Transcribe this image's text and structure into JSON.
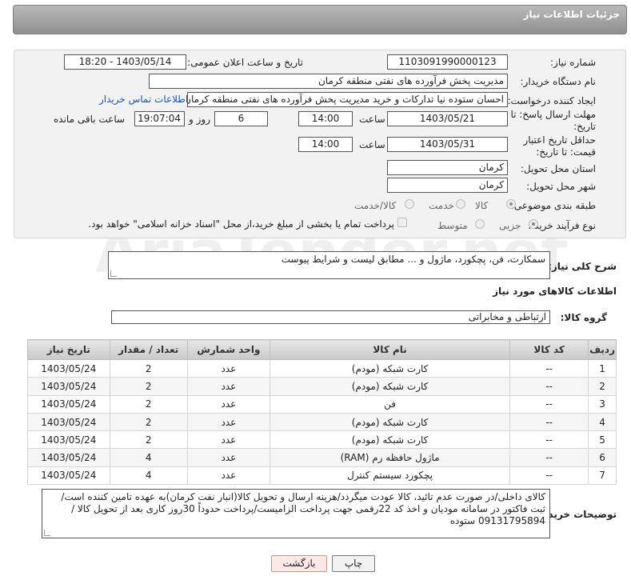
{
  "header": {
    "title": "جزئیات اطلاعات نیاز"
  },
  "form": {
    "need_number_label": "شماره نیاز:",
    "need_number": "1103091990000123",
    "announce_label": "تاریخ و ساعت اعلان عمومی:",
    "announce_value": "1403/05/14 - 18:20",
    "buyer_org_label": "نام دستگاه خریدار:",
    "buyer_org": "مدیریت پخش فرآورده های نفتی منطقه کرمان",
    "requester_label": "ایجاد کننده درخواست:",
    "requester": "احسان  ستوده نیا  تدارکات و خرید  مدیریت پخش فرآورده های نفتی منطقه کرمان",
    "contact_link": "اطلاعات تماس خریدار",
    "reply_deadline_label": "مهلت ارسال پاسخ: تا تاریخ:",
    "reply_date": "1403/05/21",
    "time_label": "ساعت",
    "reply_time": "14:00",
    "days_value": "6",
    "days_label": "روز و",
    "remaining_time": "19:07:04",
    "remaining_label": "ساعت باقی مانده",
    "price_validity_label": "حداقل تاریخ اعتبار قیمت: تا تاریخ:",
    "price_date": "1403/05/31",
    "price_time": "14:00",
    "province_label": "استان محل تحویل:",
    "province": "کرمان",
    "city_label": "شهر محل تحویل:",
    "city": "کرمان",
    "category_label": "طبقه بندی موضوعی:",
    "category_options": [
      "کالا",
      "خدمت",
      "کالا/خدمت"
    ],
    "process_label": "نوع فرآیند خرید :",
    "process_options": [
      "جزیی",
      "متوسط"
    ],
    "payment_note": "پرداخت تمام یا بخشی از مبلغ خرید،از محل \"اسناد خزانه اسلامی\" خواهد بود."
  },
  "description": {
    "label": "شرح کلی نیاز:",
    "value": "سمکارت، فن، پچکورد، ماژول و ... مطابق لیست و شرایط پیوست"
  },
  "goods": {
    "section_title": "اطلاعات کالاهای مورد نیاز",
    "group_label": "گروه کالا:",
    "group_value": "ارتباطی و مخابراتی",
    "columns": [
      "ردیف",
      "کد کالا",
      "نام کالا",
      "واحد شمارش",
      "تعداد / مقدار",
      "تاریخ نیاز"
    ],
    "rows": [
      {
        "idx": "1",
        "code": "--",
        "name": "کارت شبکه (مودم)",
        "unit": "عدد",
        "qty": "2",
        "date": "1403/05/24"
      },
      {
        "idx": "2",
        "code": "--",
        "name": "کارت شبکه (مودم)",
        "unit": "عدد",
        "qty": "2",
        "date": "1403/05/24"
      },
      {
        "idx": "3",
        "code": "--",
        "name": "فن",
        "unit": "عدد",
        "qty": "2",
        "date": "1403/05/24"
      },
      {
        "idx": "4",
        "code": "--",
        "name": "کارت شبکه (مودم)",
        "unit": "عدد",
        "qty": "2",
        "date": "1403/05/24"
      },
      {
        "idx": "5",
        "code": "--",
        "name": "کارت شبکه (مودم)",
        "unit": "عدد",
        "qty": "2",
        "date": "1403/05/24"
      },
      {
        "idx": "6",
        "code": "--",
        "name": "ماژول حافظه رم (RAM)",
        "unit": "عدد",
        "qty": "4",
        "date": "1403/05/24"
      },
      {
        "idx": "7",
        "code": "--",
        "name": "پچکورد سیستم کنترل",
        "unit": "عدد",
        "qty": "4",
        "date": "1403/05/24"
      }
    ]
  },
  "buyer_notes": {
    "label": "توضیحات خریدار:",
    "value": "کالای داخلی/در صورت عدم تائید، کالا عودت میگردد/هزینه ارسال و تحویل کالا(انبار نفت کرمان)به عهده تامین کننده است/ثبت فاکتور در سامانه مودیان و اخذ کد 22رقمی جهت پرداخت الزامیست/پرداخت حدوداً 30روز کاری بعد از تحویل کالا / 09131795894 ستوده"
  },
  "buttons": {
    "print": "چاپ",
    "back": "بازگشت"
  },
  "watermark": {
    "text": "AriaTender.net"
  }
}
